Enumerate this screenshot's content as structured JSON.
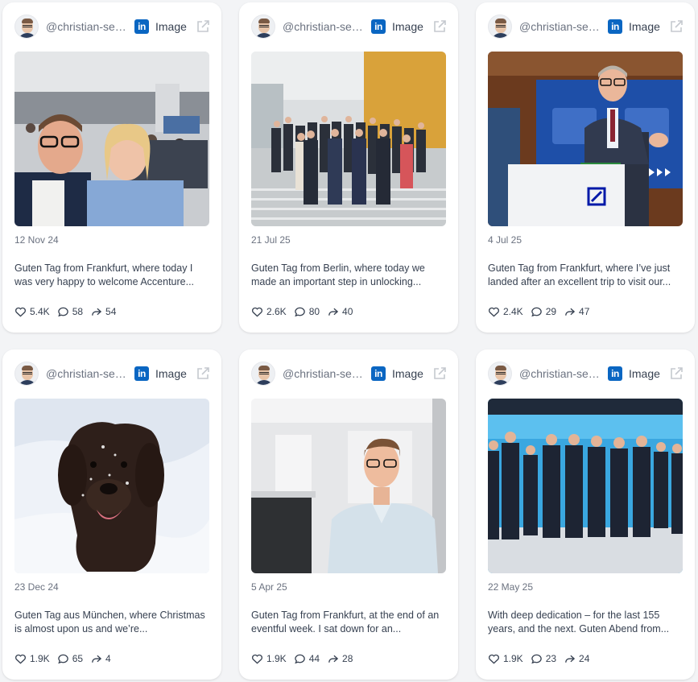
{
  "posts": [
    {
      "handle": "@christian-sewing",
      "type_label": "Image",
      "date": "12 Nov 24",
      "caption": "Guten Tag from Frankfurt, where today I was very happy to welcome Accenture...",
      "likes": "5.4K",
      "comments": "58",
      "shares": "54",
      "photo_subject": "selfie-photo"
    },
    {
      "handle": "@christian-sewing",
      "type_label": "Image",
      "date": "21 Jul 25",
      "caption": "Guten Tag from Berlin, where today we made an important step in unlocking...",
      "likes": "2.6K",
      "comments": "80",
      "shares": "40",
      "photo_subject": "group-photo"
    },
    {
      "handle": "@christian-sewing",
      "type_label": "Image",
      "date": "4 Jul 25",
      "caption": "Guten Tag from Frankfurt, where I’ve just landed after an excellent trip to visit our...",
      "likes": "2.4K",
      "comments": "29",
      "shares": "47",
      "photo_subject": "speaker-photo"
    },
    {
      "handle": "@christian-sewing",
      "type_label": "Image",
      "date": "23 Dec 24",
      "caption": "Guten Tag aus München, where Christmas is almost upon us and we’re...",
      "likes": "1.9K",
      "comments": "65",
      "shares": "4",
      "photo_subject": "dog-snow-photo"
    },
    {
      "handle": "@christian-sewing",
      "type_label": "Image",
      "date": "5 Apr 25",
      "caption": "Guten Tag from Frankfurt, at the end of an eventful week. I sat down for an...",
      "likes": "1.9K",
      "comments": "44",
      "shares": "28",
      "photo_subject": "portrait-photo"
    },
    {
      "handle": "@christian-sewing",
      "type_label": "Image",
      "date": "22 May 25",
      "caption": "With deep dedication – for the last 155 years, and the next. Guten Abend from...",
      "likes": "1.9K",
      "comments": "23",
      "shares": "24",
      "photo_subject": "team-lineup-photo"
    }
  ],
  "colors": {
    "linkedin": "#0a66c2",
    "card_bg": "#ffffff",
    "page_bg": "#f3f4f6",
    "muted_text": "#6b7280"
  },
  "icons": {
    "platform": "linkedin-icon",
    "open": "external-link-icon",
    "likes": "heart-icon",
    "comments": "comment-icon",
    "shares": "share-icon"
  }
}
